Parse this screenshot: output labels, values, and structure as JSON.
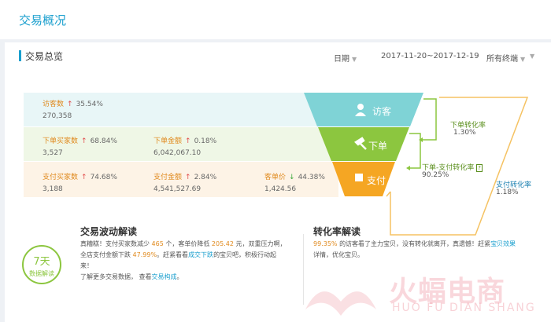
{
  "page": {
    "title": "交易概况"
  },
  "overview": {
    "title": "交易总览",
    "filters": {
      "date_label": "日期",
      "date_range": "2017-11-20~2017-12-19",
      "device": "所有终端"
    }
  },
  "funnel": {
    "visitor": {
      "label": "访客数",
      "change": "35.54%",
      "value": "270,358",
      "stage": "访客"
    },
    "order": {
      "buyers_label": "下单买家数",
      "buyers_change": "68.84%",
      "buyers_value": "3,527",
      "amount_label": "下单金额",
      "amount_change": "0.18%",
      "amount_value": "6,042,067.10",
      "stage": "下单"
    },
    "pay": {
      "buyers_label": "支付买家数",
      "buyers_change": "74.68%",
      "buyers_value": "3,188",
      "amount_label": "支付金额",
      "amount_change": "2.84%",
      "amount_value": "4,541,527.69",
      "unit_label": "客单价",
      "unit_change": "44.38%",
      "unit_value": "1,424.56",
      "stage": "支付"
    },
    "rates": {
      "order_rate_label": "下单转化率",
      "order_rate": "1.30%",
      "order_pay_label": "下单-支付转化率",
      "order_pay_rate": "90.25%",
      "pay_rate_label": "支付转化率",
      "pay_rate": "1.18%"
    }
  },
  "insight": {
    "badge_num": "7天",
    "badge_text": "数据解读",
    "title": "交易波动解读",
    "l1_a": "真糟糕！支付买家数减少",
    "l1_b": "465",
    "l1_c": "个，客单价降低",
    "l1_d": "205.42",
    "l1_e": "元，双重压力啊，",
    "l2_a": "全店支付金额下跌",
    "l2_b": "47.99%",
    "l2_c": "。赶紧看看",
    "l2_d": "成交下跌",
    "l2_e": "的宝贝吧，积极行动起",
    "l3": "来！",
    "l4_a": "了解更多交易数据，",
    "l4_b": "查看",
    "l4_c": "交易构成",
    "l4_d": "。"
  },
  "conversion": {
    "title": "转化率解读",
    "l1_a": "99.35%",
    "l1_b": "的访客看了主力宝贝，没有转化就离开，真遗憾！赶紧",
    "l1_c": "宝贝效果",
    "l2": "详情，优化宝贝。"
  },
  "watermark": {
    "cn": "火蝠电商",
    "en": "HUO FU DIAN SHANG"
  },
  "colors": {
    "accent": "#1a9fce",
    "visitor": "#7fd3d6",
    "order": "#8cc63f",
    "pay": "#f5a623"
  }
}
